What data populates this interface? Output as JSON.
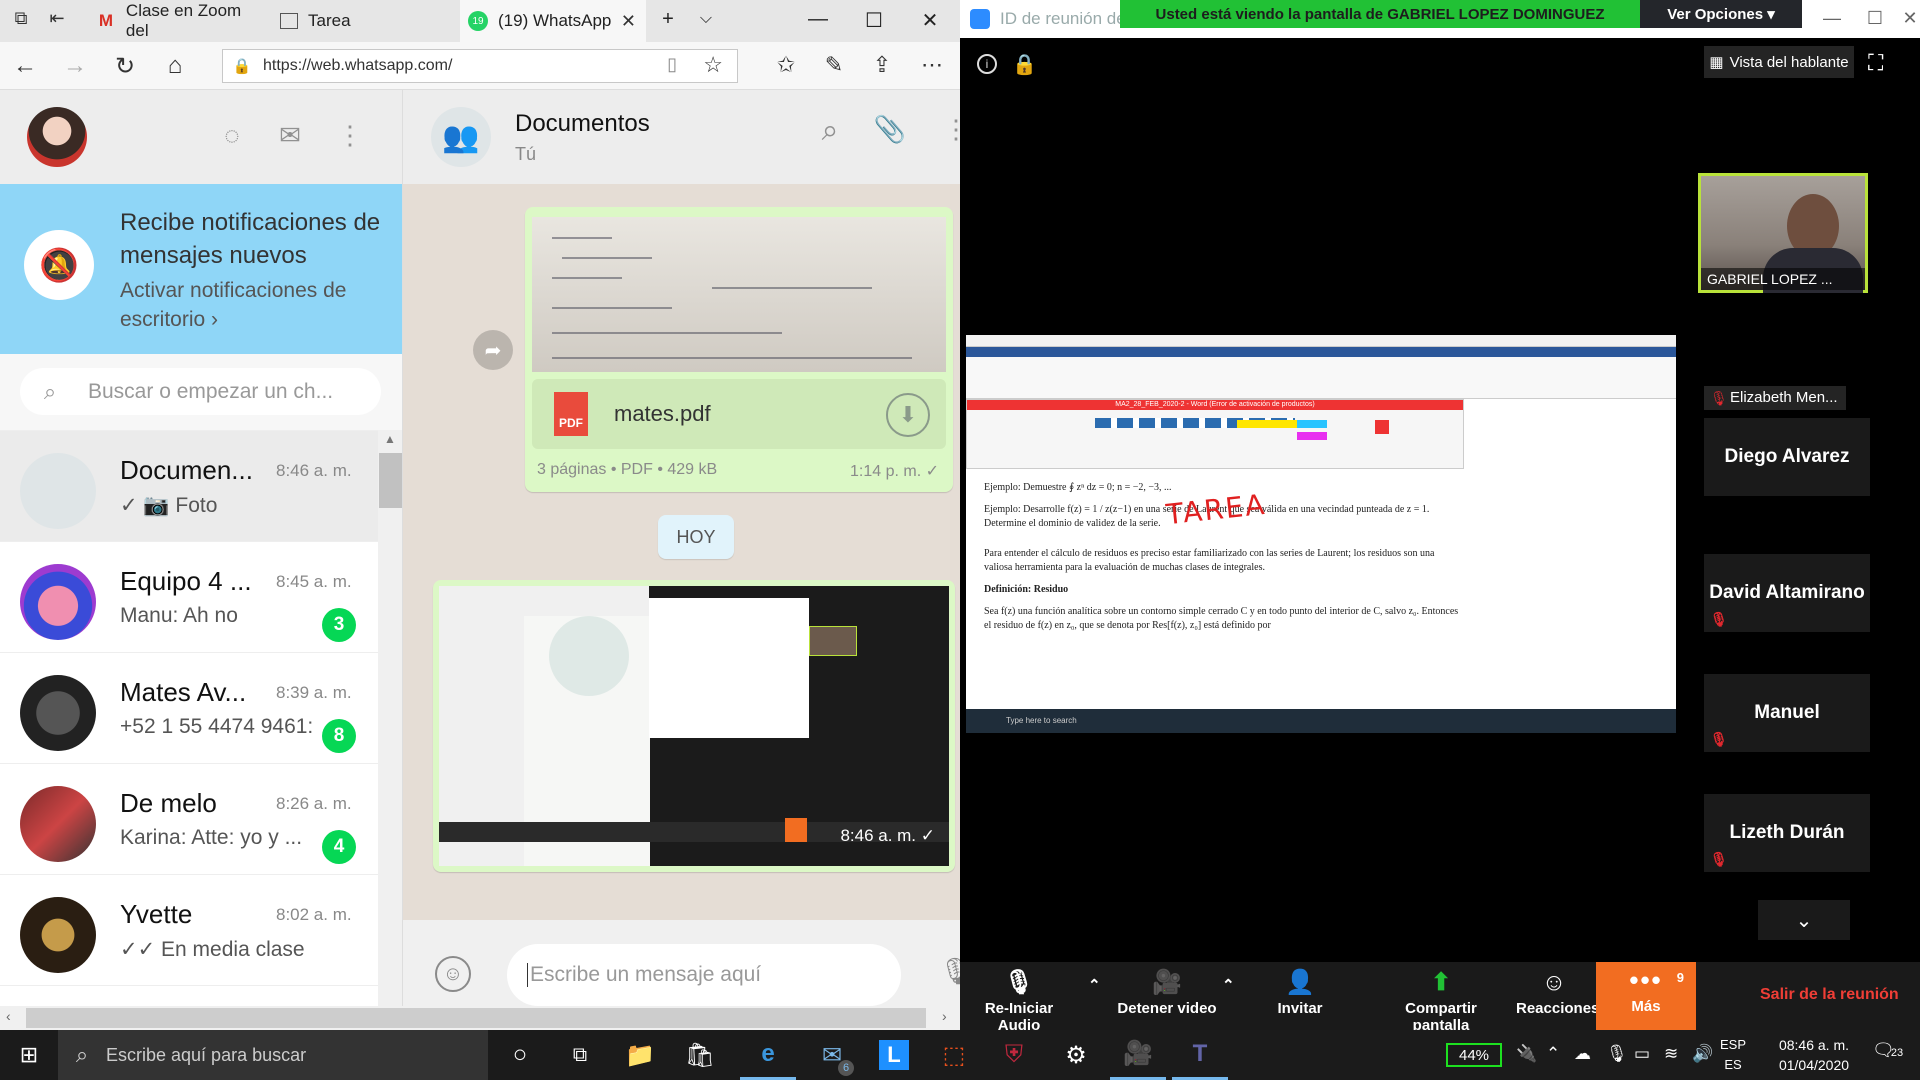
{
  "browser": {
    "tabs": [
      {
        "label": "Clase en Zoom del",
        "icon": "gmail-icon"
      },
      {
        "label": "Tarea",
        "icon": "page-icon"
      },
      {
        "label": "(19) WhatsApp",
        "icon": "whatsapp-icon",
        "badge": "19"
      }
    ],
    "url": "https://web.whatsapp.com/"
  },
  "whatsapp": {
    "notification": {
      "title": "Recibe notificaciones de mensajes nuevos",
      "subtitle": "Activar notificaciones de escritorio ›"
    },
    "search_placeholder": "Buscar o empezar un ch...",
    "chats": [
      {
        "name": "Documen...",
        "time": "8:46 a. m.",
        "preview": "✓ 📷 Foto",
        "badge": ""
      },
      {
        "name": "Equipo 4 ...",
        "time": "8:45 a. m.",
        "preview": "Manu: Ah no",
        "badge": "3"
      },
      {
        "name": "Mates Av...",
        "time": "8:39 a. m.",
        "preview": "+52 1 55 4474 9461:",
        "badge": "8"
      },
      {
        "name": "De melo",
        "time": "8:26 a. m.",
        "preview": "Karina: Atte: yo y ...",
        "badge": "4"
      },
      {
        "name": "Yvette",
        "time": "8:02 a. m.",
        "preview": "✓✓ En media clase",
        "badge": ""
      }
    ],
    "conversation": {
      "title": "Documentos",
      "subtitle": "Tú",
      "file_name": "mates.pdf",
      "file_meta": "3 páginas • PDF • 429 kB",
      "file_time": "1:14 p. m. ✓",
      "date_chip": "HOY",
      "image_time": "8:46 a. m. ✓",
      "compose_placeholder": "Escribe un mensaje aquí"
    }
  },
  "zoom": {
    "window_title": "ID de reunión de Z",
    "banner": "Usted está viendo la pantalla de GABRIEL LOPEZ DOMINGUEZ",
    "options": "Ver Opciones ▾",
    "speaker_view": "Vista del hablante",
    "host_name": "GABRIEL LOPEZ ...",
    "participants": [
      "Elizabeth Men...",
      "Diego Alvarez",
      "David Altamirano",
      "Manuel",
      "Lizeth Durán"
    ],
    "shared_doc": {
      "title": "MA2_28_FEB_2020-2 - Word (Error de activación de productos)",
      "line1": "Ejemplo: Demuestre ∮ zⁿ dz = 0;   n = −2, −3, ...",
      "line2": "Ejemplo: Desarrolle f(z) = 1 / z(z−1) en una serie de Laurent que sea válida en una vecindad punteada de z = 1. Determine el dominio de validez de la serie.",
      "annotation": "TAREA",
      "line3": "Para entender el cálculo de residuos es preciso estar familiarizado con las series de Laurent; los residuos son una valiosa herramienta para la evaluación de muchas clases de integrales.",
      "line4": "Definición: Residuo",
      "line5": "Sea f(z) una función analítica sobre un contorno simple cerrado C y en todo punto del interior de C, salvo z₀. Entonces el residuo de f(z) en z₀, que se denota por Res[f(z), z₀] está definido por",
      "taskbar_search": "Type here to search"
    },
    "toolbar": {
      "audio": "Re-Iniciar Audio",
      "video": "Detener video",
      "invite": "Invitar",
      "share": "Compartir pantalla",
      "reactions": "Reacciones",
      "more": "Más",
      "more_badge": "9",
      "leave": "Salir de la reunión"
    }
  },
  "taskbar": {
    "search_placeholder": "Escribe aquí para buscar",
    "mail_badge": "6",
    "battery": "44%",
    "lang_line1": "ESP",
    "lang_line2": "ES",
    "time": "08:46 a. m.",
    "date": "01/04/2020",
    "notification_count": "23"
  }
}
